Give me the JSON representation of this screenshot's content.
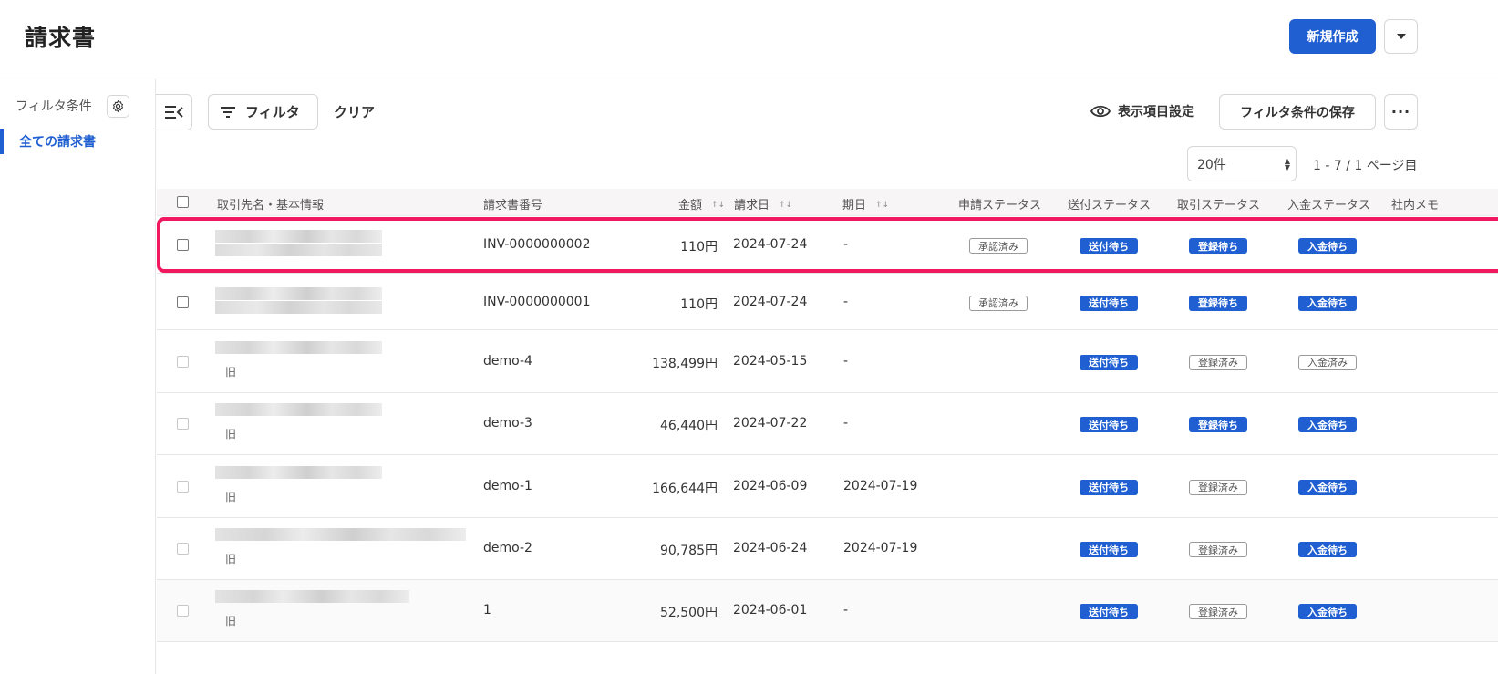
{
  "header": {
    "title": "請求書",
    "new_button": "新規作成"
  },
  "sidebar": {
    "filter_conditions": "フィルタ条件",
    "active_item": "全ての請求書"
  },
  "toolbar": {
    "filter": "フィルタ",
    "clear": "クリア",
    "display_settings": "表示項目設定",
    "save_filter": "フィルタ条件の保存",
    "more": "···"
  },
  "paging": {
    "page_size": "20件",
    "info": "1 - 7 / 1 ページ目"
  },
  "table": {
    "columns": {
      "partner": "取引先名・基本情報",
      "invoice_no": "請求書番号",
      "amount": "金額",
      "issue_date": "請求日",
      "due_date": "期日",
      "application_status": "申請ステータス",
      "send_status": "送付ステータス",
      "deal_status": "取引ステータス",
      "payment_status": "入金ステータス",
      "internal_memo": "社内メモ"
    },
    "rows": [
      {
        "old": "",
        "invoice_no": "INV-0000000002",
        "amount": "110円",
        "issue_date": "2024-07-24",
        "due_date": "-",
        "application_status": "承認済み",
        "send_status": "送付待ち",
        "deal_status": "登録待ち",
        "payment_status": "入金待ち"
      },
      {
        "old": "",
        "invoice_no": "INV-0000000001",
        "amount": "110円",
        "issue_date": "2024-07-24",
        "due_date": "-",
        "application_status": "承認済み",
        "send_status": "送付待ち",
        "deal_status": "登録待ち",
        "payment_status": "入金待ち"
      },
      {
        "old": "旧",
        "invoice_no": "demo-4",
        "amount": "138,499円",
        "issue_date": "2024-05-15",
        "due_date": "-",
        "application_status": "",
        "send_status": "送付待ち",
        "deal_status": "登録済み",
        "payment_status": "入金済み"
      },
      {
        "old": "旧",
        "invoice_no": "demo-3",
        "amount": "46,440円",
        "issue_date": "2024-07-22",
        "due_date": "-",
        "application_status": "",
        "send_status": "送付待ち",
        "deal_status": "登録待ち",
        "payment_status": "入金待ち"
      },
      {
        "old": "旧",
        "invoice_no": "demo-1",
        "amount": "166,644円",
        "issue_date": "2024-06-09",
        "due_date": "2024-07-19",
        "application_status": "",
        "send_status": "送付待ち",
        "deal_status": "登録済み",
        "payment_status": "入金待ち"
      },
      {
        "old": "旧",
        "invoice_no": "demo-2",
        "amount": "90,785円",
        "issue_date": "2024-06-24",
        "due_date": "2024-07-19",
        "application_status": "",
        "send_status": "送付待ち",
        "deal_status": "登録済み",
        "payment_status": "入金待ち"
      },
      {
        "old": "旧",
        "invoice_no": "1",
        "amount": "52,500円",
        "issue_date": "2024-06-01",
        "due_date": "-",
        "application_status": "",
        "send_status": "送付待ち",
        "deal_status": "登録済み",
        "payment_status": "入金待ち"
      }
    ]
  },
  "colors": {
    "primary": "#1f5fd1",
    "highlight": "#f0185f"
  }
}
